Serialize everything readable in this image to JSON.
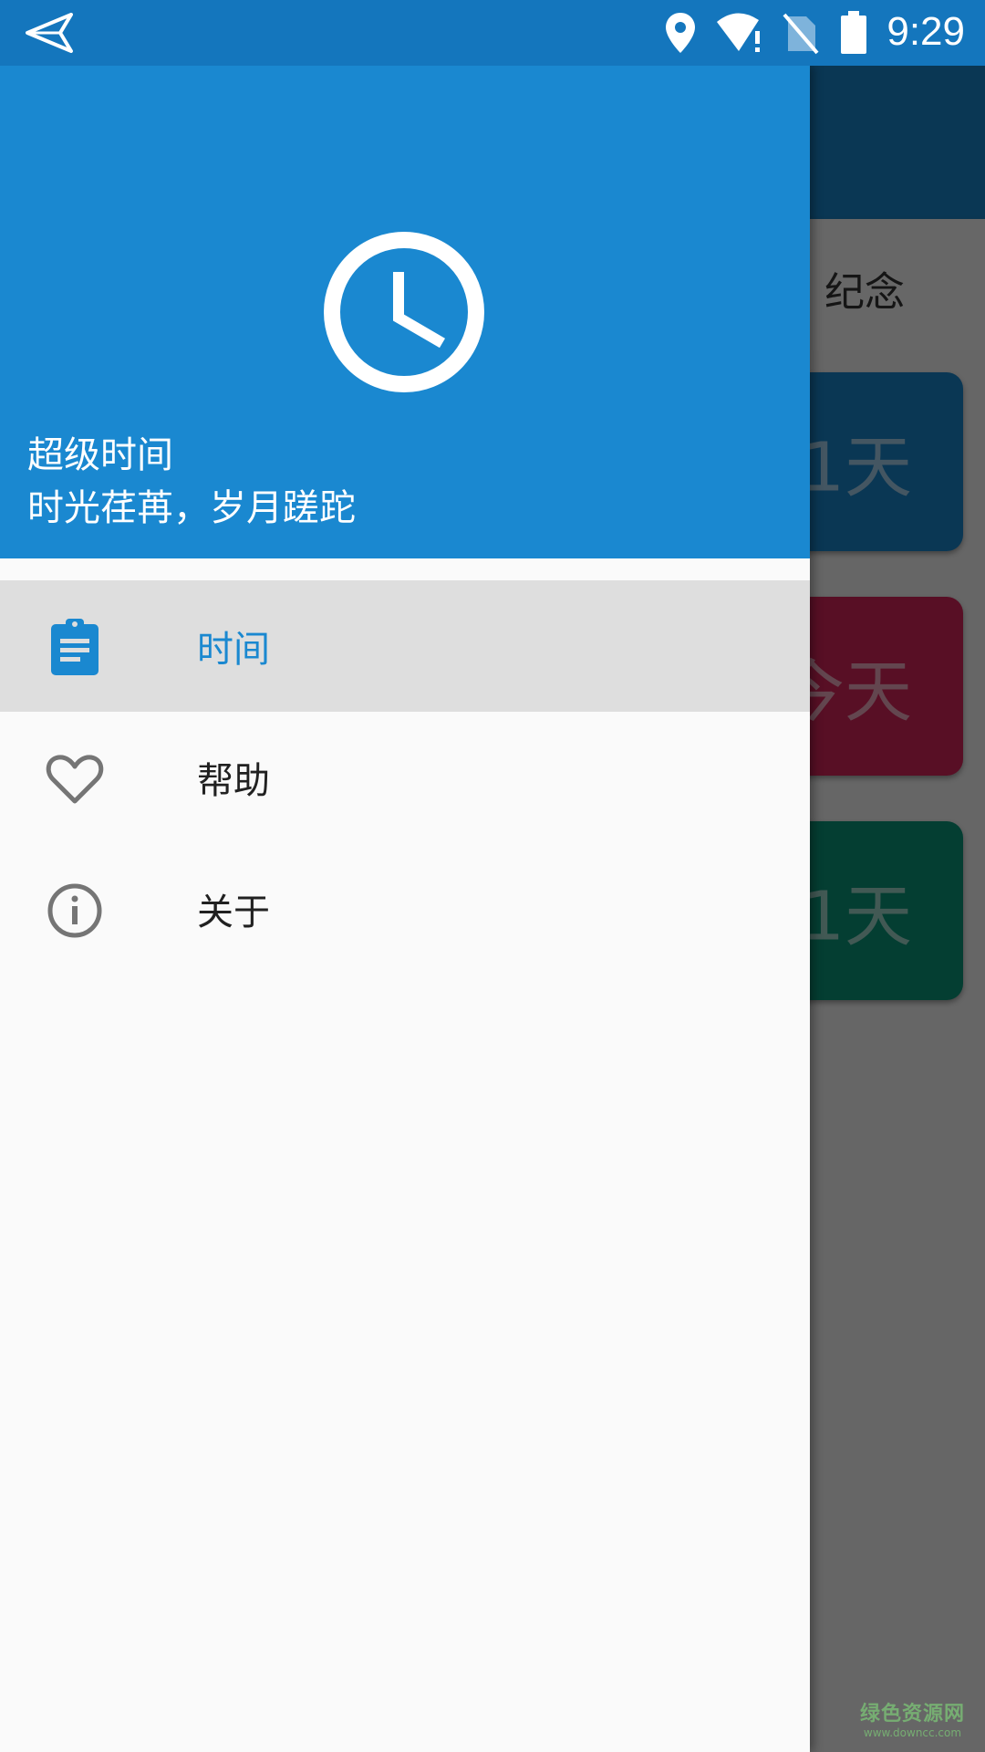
{
  "status_bar": {
    "time": "9:29",
    "icons": [
      "send-icon",
      "location-icon",
      "wifi-alert-icon",
      "no-sim-icon",
      "battery-icon"
    ]
  },
  "background_app": {
    "tab_label": "纪念",
    "cards": [
      {
        "text": "1天",
        "color": "#1a84c8"
      },
      {
        "text": "今天",
        "color": "#d2245a"
      },
      {
        "text": "1天",
        "color": "#0a9478"
      }
    ]
  },
  "drawer": {
    "header": {
      "icon": "clock-icon",
      "title": "超级时间",
      "subtitle": "时光荏苒，岁月蹉跎",
      "color": "#1a88d0"
    },
    "menu": [
      {
        "label": "时间",
        "icon": "clipboard-icon",
        "selected": true
      },
      {
        "label": "帮助",
        "icon": "heart-icon",
        "selected": false
      },
      {
        "label": "关于",
        "icon": "info-icon",
        "selected": false
      }
    ]
  },
  "watermark": {
    "line1": "绿色资源网",
    "line2": "www.downcc.com"
  }
}
